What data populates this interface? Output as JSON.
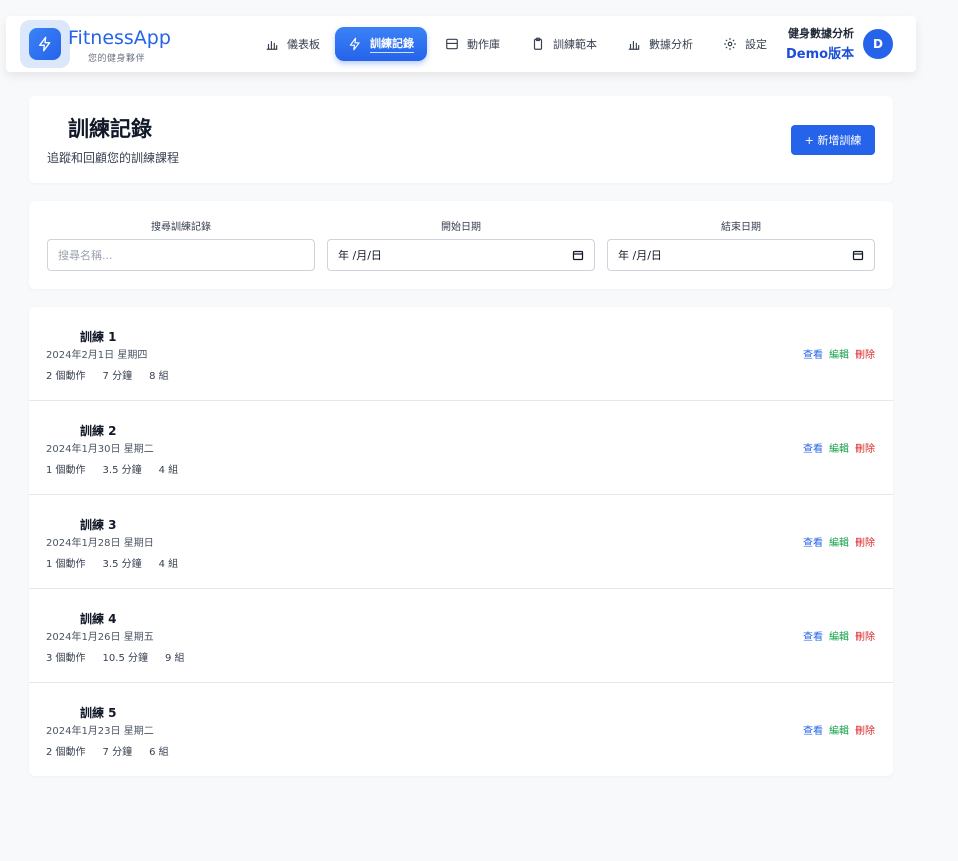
{
  "app": {
    "name": "FitnessApp",
    "tagline": "您的健身夥伴"
  },
  "nav": {
    "items": [
      {
        "label": "儀表板",
        "icon": "bar-chart-icon"
      },
      {
        "label": "訓練記錄",
        "icon": "lightning-icon",
        "active": true
      },
      {
        "label": "動作庫",
        "icon": "layout-icon"
      },
      {
        "label": "訓練範本",
        "icon": "clipboard-icon"
      },
      {
        "label": "數據分析",
        "icon": "bar-chart-icon"
      },
      {
        "label": "設定",
        "icon": "gear-icon"
      }
    ],
    "user_title": "健身數據分析",
    "user_sub": "Demo版本",
    "avatar_initial": "D"
  },
  "header": {
    "title": "訓練記錄",
    "subtitle": "追蹤和回顧您的訓練課程",
    "add_button": "+ 新增訓練"
  },
  "filters": {
    "search_label": "搜尋訓練記錄",
    "search_placeholder": "搜尋名稱...",
    "start_label": "開始日期",
    "start_value": "年 /月/日",
    "end_label": "結束日期",
    "end_value": "年 /月/日"
  },
  "actions": {
    "view": "查看",
    "edit": "編輯",
    "delete": "刪除"
  },
  "workouts": [
    {
      "name": "訓練 1",
      "date": "2024年2月1日 星期四",
      "exercises": "2 個動作",
      "duration": "7 分鐘",
      "sets": "8 組"
    },
    {
      "name": "訓練 2",
      "date": "2024年1月30日 星期二",
      "exercises": "1 個動作",
      "duration": "3.5 分鐘",
      "sets": "4 組"
    },
    {
      "name": "訓練 3",
      "date": "2024年1月28日 星期日",
      "exercises": "1 個動作",
      "duration": "3.5 分鐘",
      "sets": "4 組"
    },
    {
      "name": "訓練 4",
      "date": "2024年1月26日 星期五",
      "exercises": "3 個動作",
      "duration": "10.5 分鐘",
      "sets": "9 組"
    },
    {
      "name": "訓練 5",
      "date": "2024年1月23日 星期二",
      "exercises": "2 個動作",
      "duration": "7 分鐘",
      "sets": "6 組"
    }
  ],
  "colors": {
    "primary": "#2563eb",
    "edit": "#16a34a",
    "delete": "#dc2626"
  }
}
